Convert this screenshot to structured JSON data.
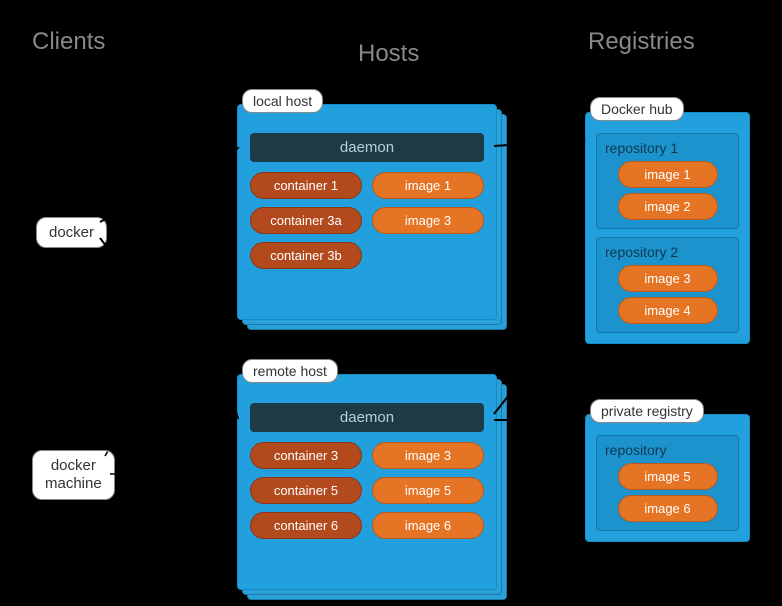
{
  "titles": {
    "clients": "Clients",
    "hosts": "Hosts",
    "registries": "Registries"
  },
  "clients": {
    "docker": "docker",
    "machine": "docker\nmachine"
  },
  "local_host": {
    "label": "local host",
    "daemon": "daemon",
    "containers": [
      "container 1",
      "container 3a",
      "container 3b"
    ],
    "images": [
      "image 1",
      "image 3"
    ]
  },
  "remote_host": {
    "label": "remote host",
    "daemon": "daemon",
    "containers": [
      "container 3",
      "container 5",
      "container 6"
    ],
    "images": [
      "image 3",
      "image 5",
      "image 6"
    ]
  },
  "docker_hub": {
    "label": "Docker hub",
    "repos": [
      {
        "title": "repository 1",
        "images": [
          "image 1",
          "image 2"
        ]
      },
      {
        "title": "repository 2",
        "images": [
          "image 3",
          "image 4"
        ]
      }
    ]
  },
  "private_registry": {
    "label": "private registry",
    "repos": [
      {
        "title": "repository",
        "images": [
          "image 5",
          "image 6"
        ]
      }
    ]
  }
}
